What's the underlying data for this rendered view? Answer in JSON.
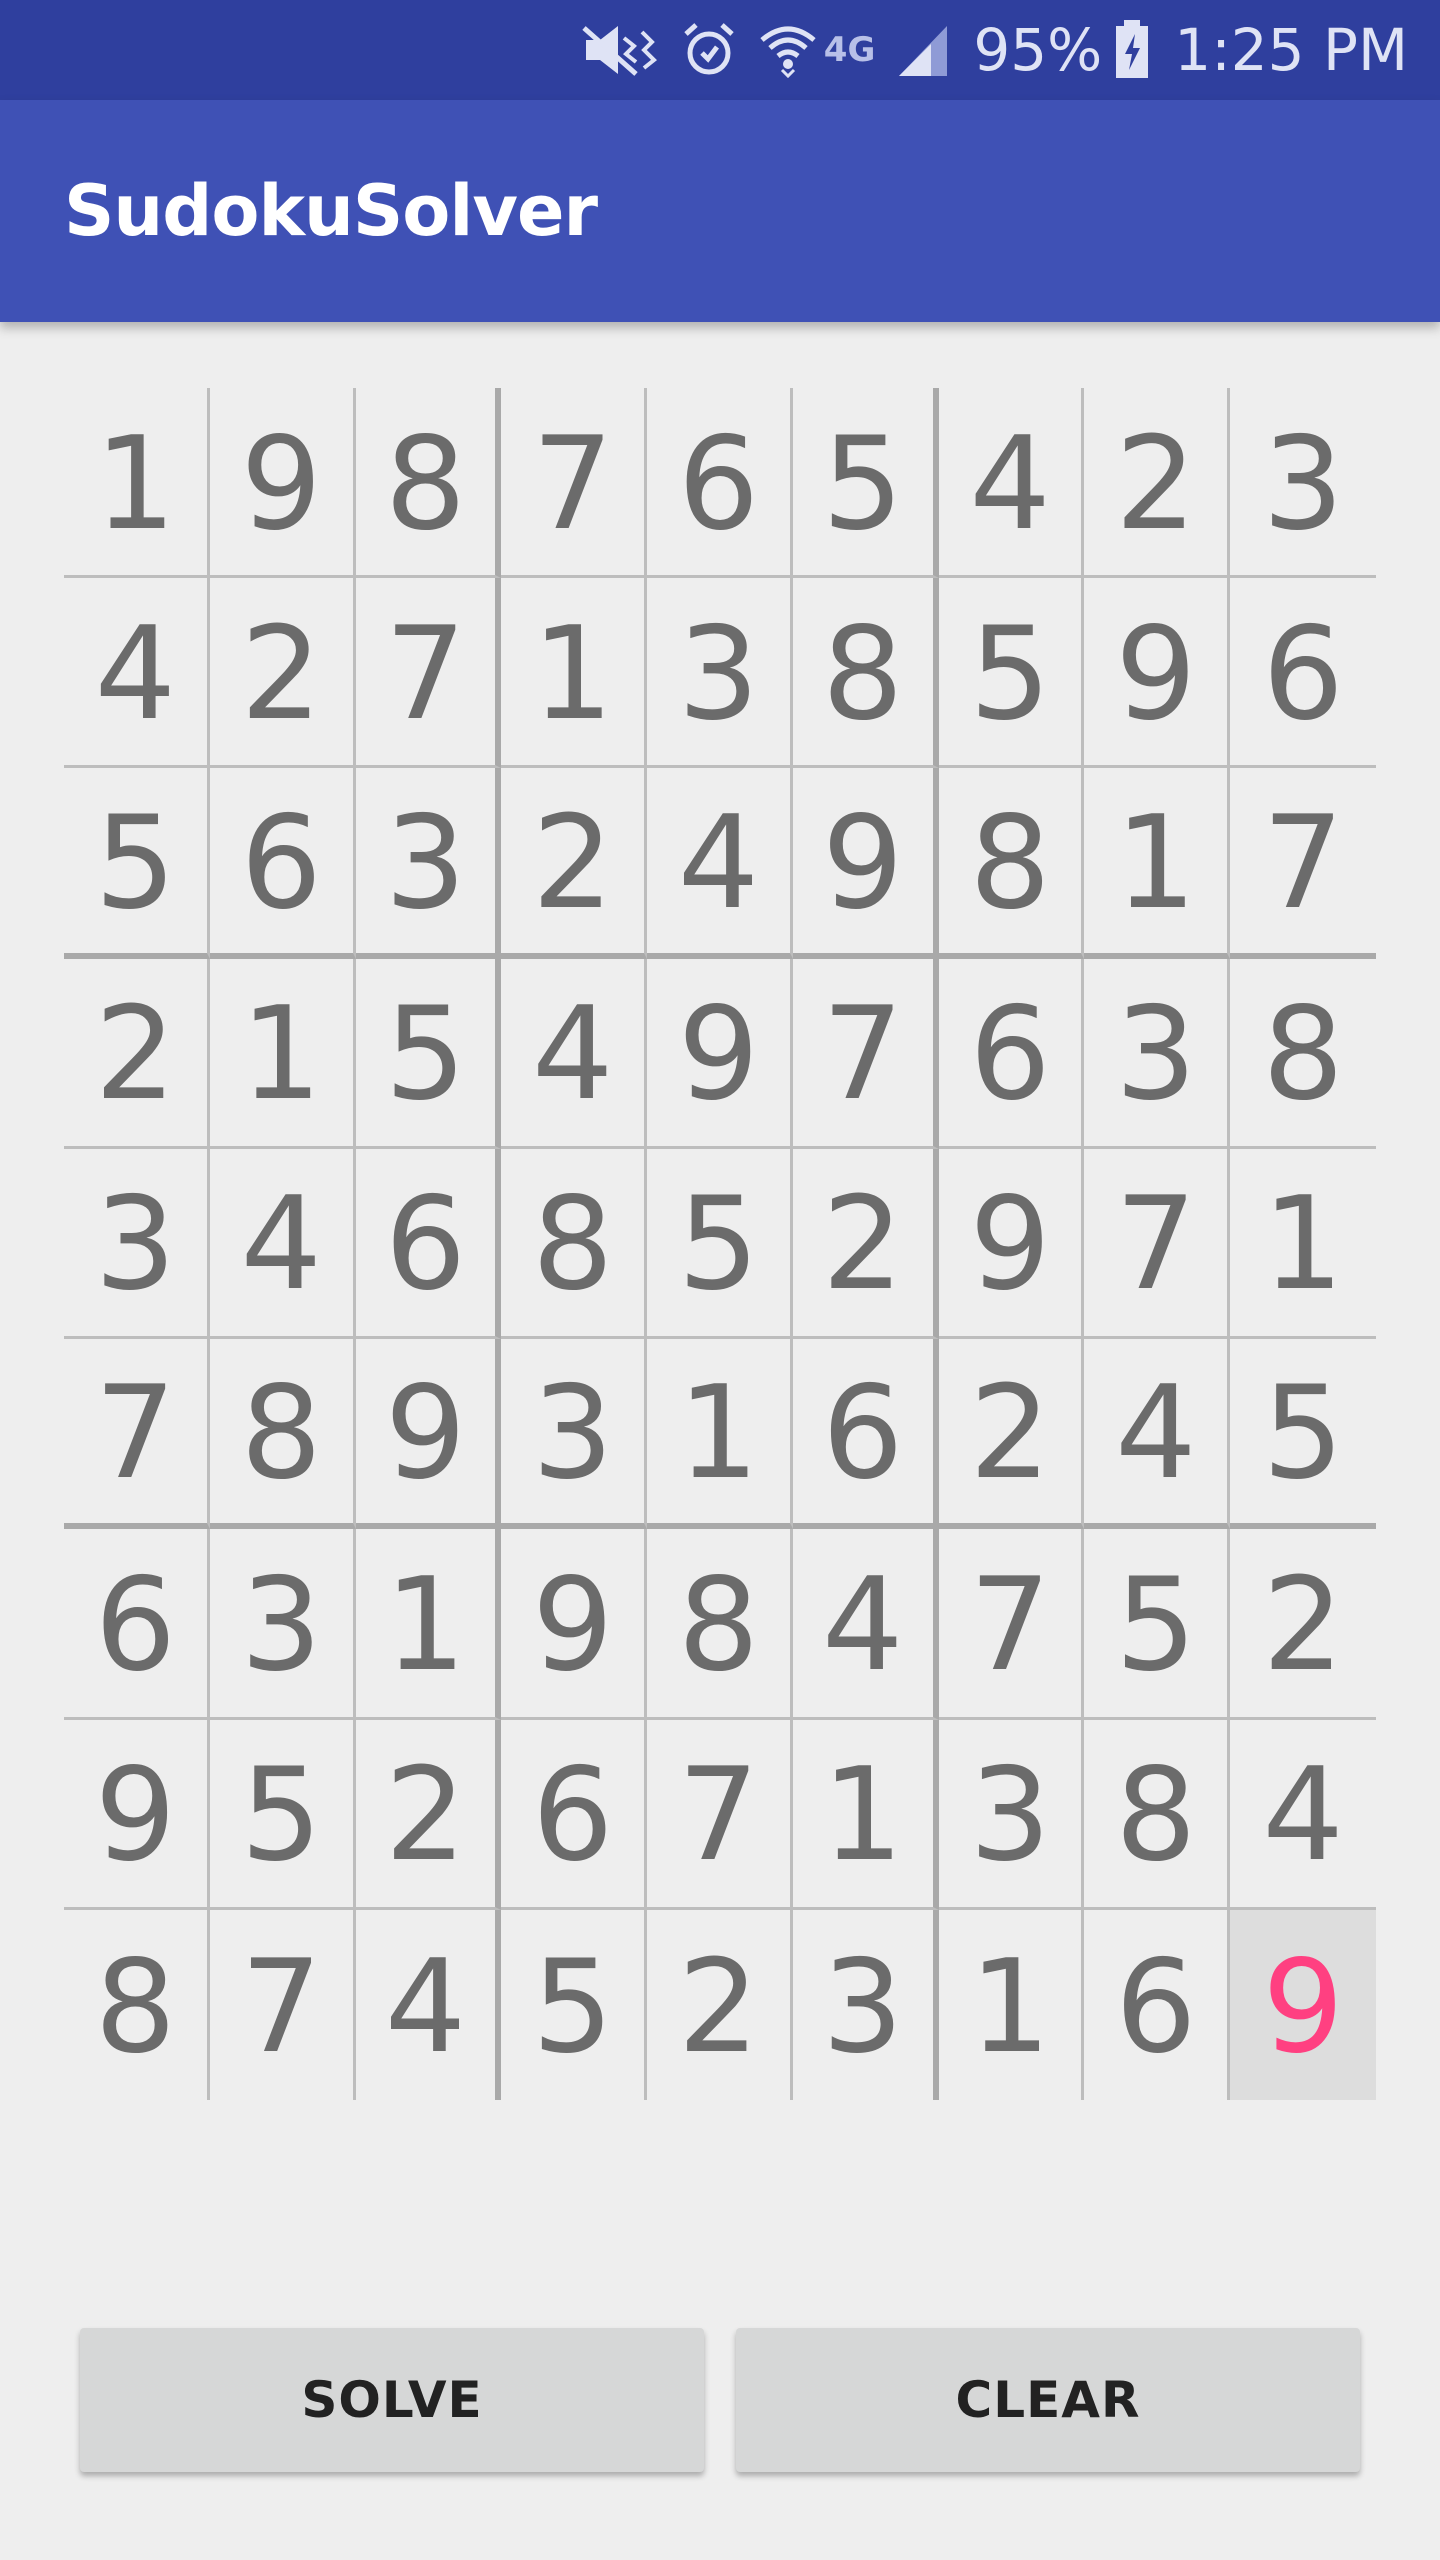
{
  "status_bar": {
    "battery": "95%",
    "time": "1:25 PM",
    "network_label": "4G",
    "icons": [
      "mute-icon",
      "alarm-icon",
      "wifi-icon",
      "signal-icon",
      "battery-charging-icon"
    ]
  },
  "app_bar": {
    "title": "SudokuSolver"
  },
  "grid": {
    "rows": [
      [
        "1",
        "9",
        "8",
        "7",
        "6",
        "5",
        "4",
        "2",
        "3"
      ],
      [
        "4",
        "2",
        "7",
        "1",
        "3",
        "8",
        "5",
        "9",
        "6"
      ],
      [
        "5",
        "6",
        "3",
        "2",
        "4",
        "9",
        "8",
        "1",
        "7"
      ],
      [
        "2",
        "1",
        "5",
        "4",
        "9",
        "7",
        "6",
        "3",
        "8"
      ],
      [
        "3",
        "4",
        "6",
        "8",
        "5",
        "2",
        "9",
        "7",
        "1"
      ],
      [
        "7",
        "8",
        "9",
        "3",
        "1",
        "6",
        "2",
        "4",
        "5"
      ],
      [
        "6",
        "3",
        "1",
        "9",
        "8",
        "4",
        "7",
        "5",
        "2"
      ],
      [
        "9",
        "5",
        "2",
        "6",
        "7",
        "1",
        "3",
        "8",
        "4"
      ],
      [
        "8",
        "7",
        "4",
        "5",
        "2",
        "3",
        "1",
        "6",
        "9"
      ]
    ],
    "selected_cell": {
      "row": 8,
      "col": 8
    }
  },
  "buttons": {
    "solve": "SOLVE",
    "clear": "CLEAR"
  },
  "colors": {
    "status_bar": "#2f3f9e",
    "app_bar": "#3f51b5",
    "accent": "#ff4081",
    "digit": "#6b6b6b",
    "background": "#eeeeee"
  }
}
